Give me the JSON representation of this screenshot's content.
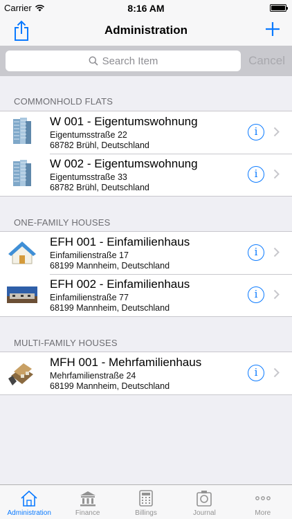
{
  "status": {
    "carrier": "Carrier",
    "time": "8:16 AM"
  },
  "nav": {
    "title": "Administration",
    "left_icon": "share-icon",
    "right_icon": "plus-icon"
  },
  "search": {
    "placeholder": "Search Item",
    "cancel_label": "Cancel"
  },
  "sections": [
    {
      "header": "COMMONHOLD FLATS",
      "items": [
        {
          "title": "W 001 - Eigentumswohnung",
          "street": "Eigentumsstraße 22",
          "city": "68782 Brühl, Deutschland",
          "thumb": "apartment-building-icon"
        },
        {
          "title": "W 002 - Eigentumswohnung",
          "street": "Eigentumsstraße 33",
          "city": "68782 Brühl, Deutschland",
          "thumb": "apartment-building-icon"
        }
      ]
    },
    {
      "header": "ONE-FAMILY HOUSES",
      "items": [
        {
          "title": "EFH 001 - Einfamilienhaus",
          "street": "Einfamilienstraße 17",
          "city": "68199 Mannheim, Deutschland",
          "thumb": "house-icon"
        },
        {
          "title": "EFH 002 - Einfamilienhaus",
          "street": "Einfamilienstraße 77",
          "city": "68199 Mannheim, Deutschland",
          "thumb": "house-photo"
        }
      ]
    },
    {
      "header": "MULTI-FAMILY HOUSES",
      "items": [
        {
          "title": "MFH 001 - Mehrfamilienhaus",
          "street": "Mehrfamilienstraße 24",
          "city": "68199 Mannheim, Deutschland",
          "thumb": "multi-family-house-icon"
        }
      ]
    }
  ],
  "tabs": [
    {
      "label": "Administration",
      "icon": "house-outline-icon",
      "active": true
    },
    {
      "label": "Finance",
      "icon": "bank-icon",
      "active": false
    },
    {
      "label": "Billings",
      "icon": "calculator-icon",
      "active": false
    },
    {
      "label": "Journal",
      "icon": "camera-icon",
      "active": false
    },
    {
      "label": "More",
      "icon": "more-dots-icon",
      "active": false
    }
  ],
  "colors": {
    "accent": "#0a7aff",
    "nav_background": "#f7f7f8",
    "list_background": "#efeff4",
    "search_background": "#c9c9ce"
  }
}
